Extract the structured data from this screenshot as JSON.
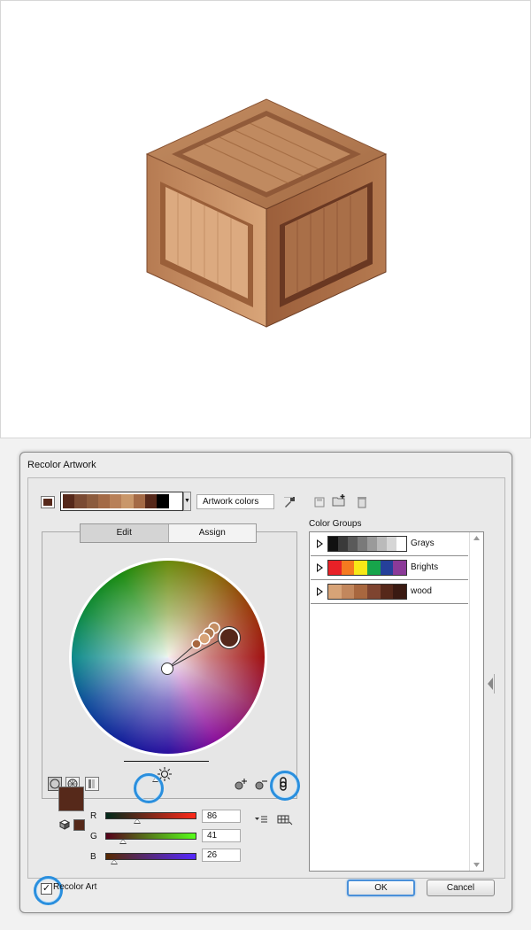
{
  "dialog": {
    "title": "Recolor Artwork",
    "artwork_colors_field": "Artwork colors",
    "current_strip": [
      "#56281a",
      "#7a4a33",
      "#8c5b3d",
      "#a36a46",
      "#b88058",
      "#c9976a",
      "#a46a46",
      "#56281a",
      "#000000",
      "#ffffff"
    ],
    "tabs": {
      "edit": "Edit",
      "assign": "Assign"
    },
    "color_groups_label": "Color Groups",
    "color_groups": [
      {
        "name": "Grays",
        "chips": [
          "#111111",
          "#3a3a3a",
          "#5a5a5a",
          "#7a7a7a",
          "#9a9a9a",
          "#bababa",
          "#d6d6d6",
          "#ffffff"
        ]
      },
      {
        "name": "Brights",
        "chips": [
          "#e82127",
          "#f47a20",
          "#f7e817",
          "#17a54b",
          "#25409a",
          "#8b3a98"
        ]
      },
      {
        "name": "wood",
        "chips": [
          "#d7a377",
          "#c2875d",
          "#a8673f",
          "#7e4430",
          "#56281a",
          "#3a1a12"
        ]
      }
    ],
    "selected_color": "#56291a",
    "rgb": {
      "r": {
        "label": "R",
        "value": "86"
      },
      "g": {
        "label": "G",
        "value": "41"
      },
      "b": {
        "label": "B",
        "value": "26"
      }
    },
    "recolor_art_label": "Recolor Art",
    "recolor_art_checked": "✓",
    "ok_label": "OK",
    "cancel_label": "Cancel"
  }
}
